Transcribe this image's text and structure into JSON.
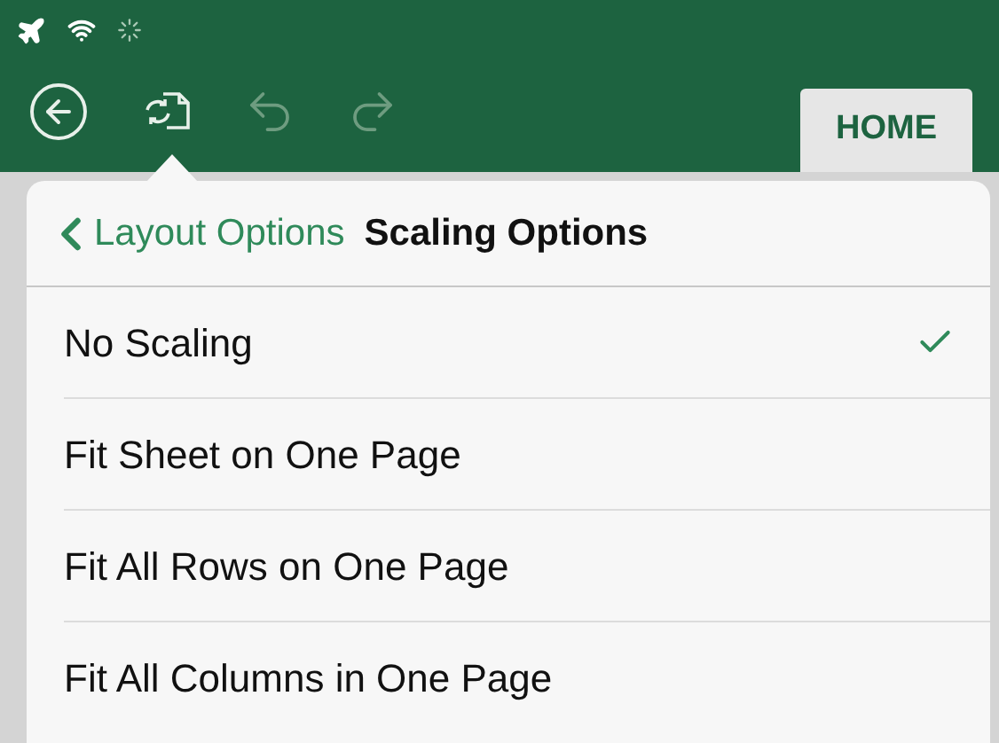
{
  "toolbar": {
    "undo": {
      "disabled": true
    },
    "redo": {
      "disabled": true
    }
  },
  "tabs": [
    {
      "label": "HOME",
      "selected": true
    }
  ],
  "popover": {
    "back_label": "Layout Options",
    "title": "Scaling Options",
    "options": [
      {
        "label": "No Scaling",
        "selected": true
      },
      {
        "label": "Fit Sheet on One Page",
        "selected": false
      },
      {
        "label": "Fit All Rows on One Page",
        "selected": false
      },
      {
        "label": "Fit All Columns in One Page",
        "selected": false
      }
    ]
  }
}
